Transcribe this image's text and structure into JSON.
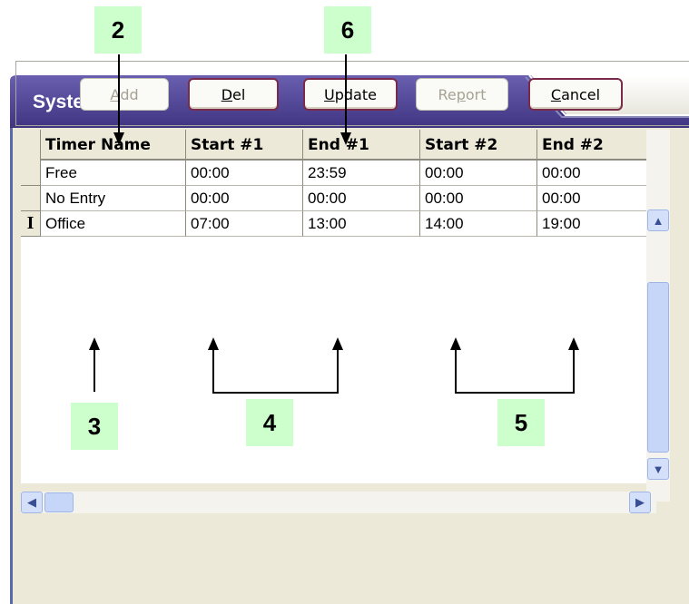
{
  "window": {
    "title": "System Timer"
  },
  "toolbar": {
    "add": {
      "pre": "",
      "key": "A",
      "post": "dd"
    },
    "del": {
      "pre": "",
      "key": "D",
      "post": "el"
    },
    "update": {
      "pre": "",
      "key": "U",
      "post": "pdate"
    },
    "report": {
      "pre": "Re",
      "key": "p",
      "post": "ort"
    },
    "cancel": {
      "pre": "",
      "key": "C",
      "post": "ancel"
    }
  },
  "grid": {
    "headers": [
      "Timer Name",
      "Start #1",
      "End #1",
      "Start #2",
      "End #2"
    ],
    "rows": [
      [
        "Free",
        "00:00",
        "23:59",
        "00:00",
        "00:00"
      ],
      [
        "No Entry",
        "00:00",
        "00:00",
        "00:00",
        "00:00"
      ],
      [
        "Office",
        "07:00",
        "13:00",
        "14:00",
        "19:00"
      ]
    ],
    "current_row_marker": "I"
  },
  "callouts": {
    "c2": "2",
    "c3": "3",
    "c4": "4",
    "c5": "5",
    "c6": "6"
  },
  "colors": {
    "titlebar": "#4a3f8e",
    "callout_bg": "#ccffcc",
    "window_bg": "#ece9d8"
  }
}
